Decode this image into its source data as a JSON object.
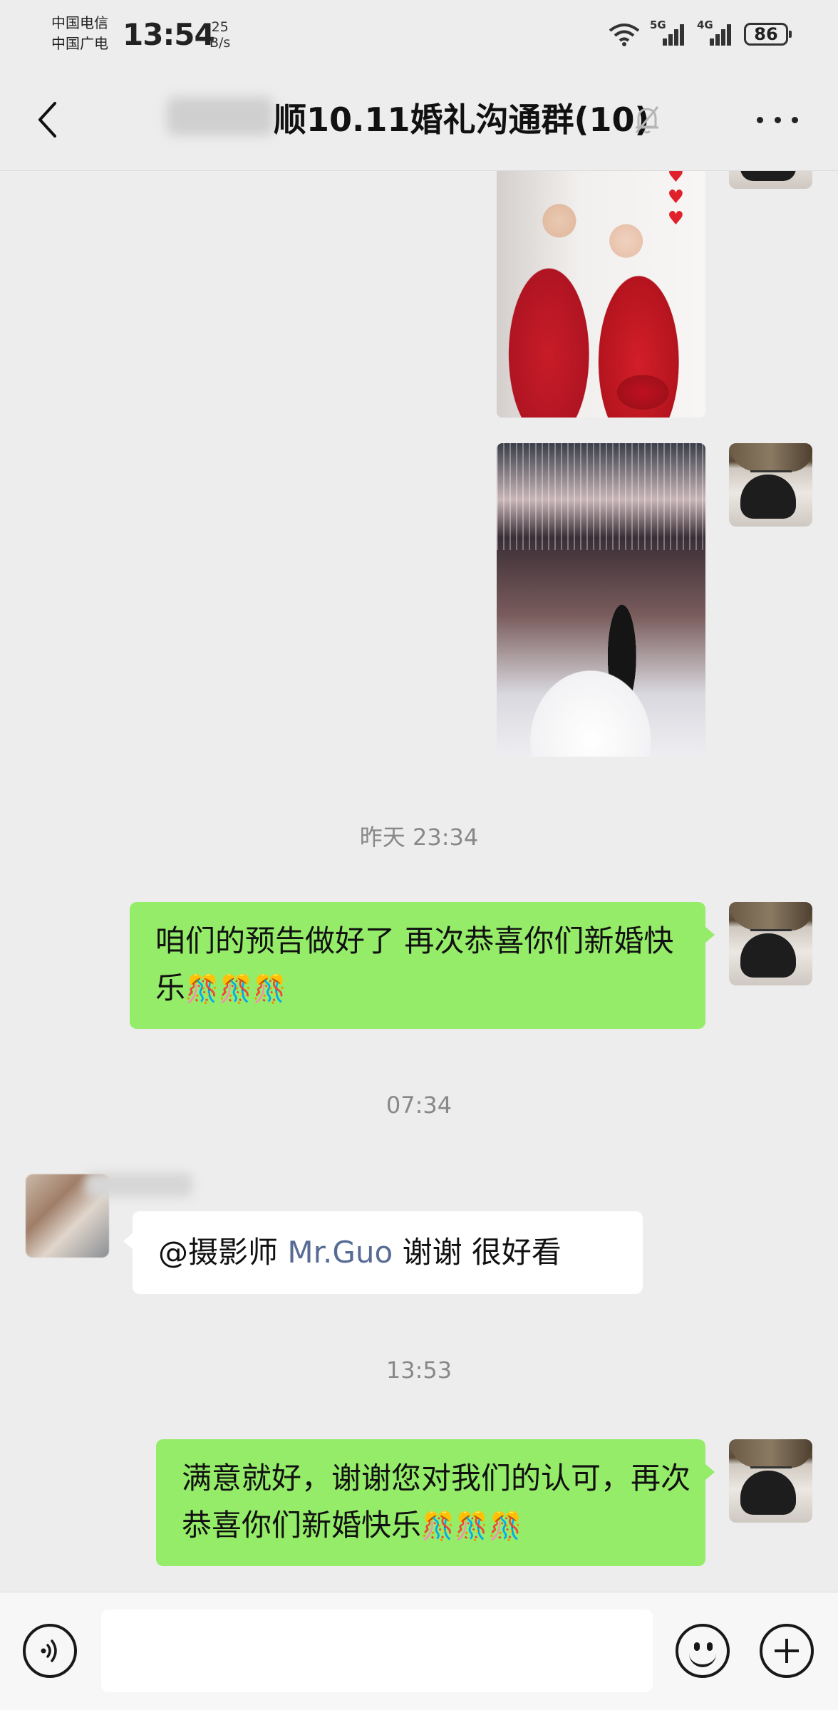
{
  "status_bar": {
    "carrier_1": "中国电信",
    "carrier_2": "中国广电",
    "time": "13:54",
    "net_speed_value": "25",
    "net_speed_unit": "B/s",
    "network_1": "5G",
    "network_2": "4G",
    "battery": "86"
  },
  "header": {
    "title": "顺10.11婚礼沟通群(10)",
    "muted": true
  },
  "chat": {
    "timestamps": [
      "昨天 23:34",
      "07:34",
      "13:53"
    ],
    "messages": [
      {
        "type": "image",
        "from": "me",
        "description_icon": "wedding-photo-icon"
      },
      {
        "type": "image",
        "from": "me",
        "description_icon": "wedding-photo-icon"
      },
      {
        "type": "text",
        "from": "me",
        "text": "咱们的预告做好了   再次恭喜你们新婚快乐",
        "emoji": "🎊🎊🎊"
      },
      {
        "type": "text",
        "from": "other",
        "sender": "",
        "mention": "@摄影师 ",
        "mention_name": "Mr.Guo",
        "text": " 谢谢 很好看"
      },
      {
        "type": "text",
        "from": "me",
        "text": "满意就好，谢谢您对我们的认可，再次恭喜你们新婚快乐",
        "emoji": "🎊🎊🎊"
      }
    ]
  },
  "input_bar": {
    "value": "",
    "placeholder": ""
  },
  "colors": {
    "background": "#ededed",
    "bubble_me": "#95ec69",
    "bubble_other": "#ffffff",
    "mention": "#576b95"
  }
}
